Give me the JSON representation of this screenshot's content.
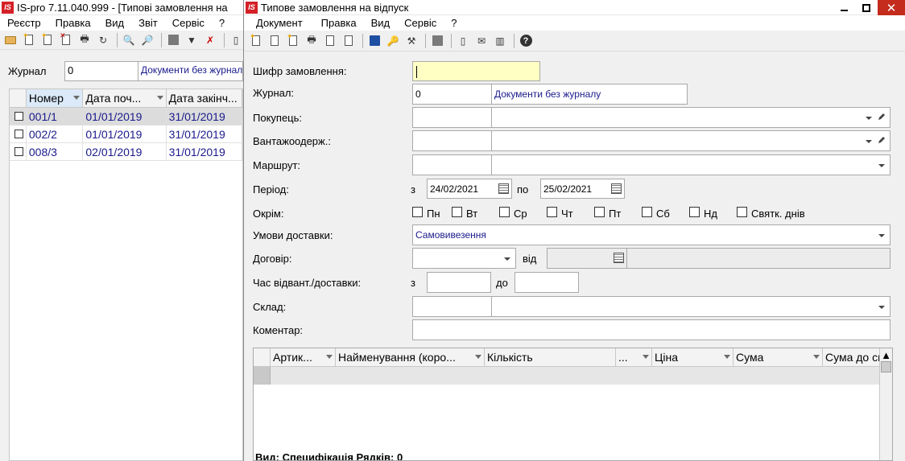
{
  "main_window": {
    "app_logo": "IS",
    "title": "IS-pro 7.11.040.999 - [Типові замовлення на",
    "menu": [
      "Реєстр",
      "Правка",
      "Вид",
      "Звіт",
      "Сервіс",
      "?"
    ],
    "journal_label": "Журнал",
    "journal_value": "0",
    "journal_name": "Документи без журнал",
    "grid": {
      "columns": [
        "Номер",
        "Дата поч...",
        "Дата закінч..."
      ],
      "rows": [
        {
          "number": "001/1",
          "date_from": "01/01/2019",
          "date_to": "31/01/2019"
        },
        {
          "number": "002/2",
          "date_from": "01/01/2019",
          "date_to": "31/01/2019"
        },
        {
          "number": "008/3",
          "date_from": "02/01/2019",
          "date_to": "31/01/2019"
        }
      ]
    }
  },
  "dialog": {
    "app_logo": "IS",
    "title": "Типове замовлення на відпуск",
    "menu": [
      "Документ",
      "Правка",
      "Вид",
      "Сервіс",
      "?"
    ],
    "form": {
      "order_code_label": "Шифр замовлення:",
      "order_code_value": "",
      "journal_label": "Журнал:",
      "journal_value": "0",
      "journal_name": "Документи без журналу",
      "buyer_label": "Покупець:",
      "consignee_label": "Вантажоодерж.:",
      "route_label": "Маршрут:",
      "period_label": "Період:",
      "period_from_prefix": "з",
      "period_from": "24/02/2021",
      "period_to_prefix": "по",
      "period_to": "25/02/2021",
      "except_label": "Окрім:",
      "weekdays": [
        "Пн",
        "Вт",
        "Ср",
        "Чт",
        "Пт",
        "Сб",
        "Нд",
        "Святк. днів"
      ],
      "delivery_label": "Умови доставки:",
      "delivery_value": "Самовивезення",
      "contract_label": "Договір:",
      "contract_from_label": "від",
      "ship_time_label": "Час відвант./доставки:",
      "ship_time_from_prefix": "з",
      "ship_time_to_prefix": "до",
      "warehouse_label": "Склад:",
      "comment_label": "Коментар:"
    },
    "spec_grid": {
      "columns": [
        "Артик...",
        "Найменування (коро...",
        "Кількість",
        "...",
        "Ціна",
        "Сума",
        "Сума до сп"
      ],
      "status": "Вид: Специфікація    Рядків: 0"
    }
  }
}
